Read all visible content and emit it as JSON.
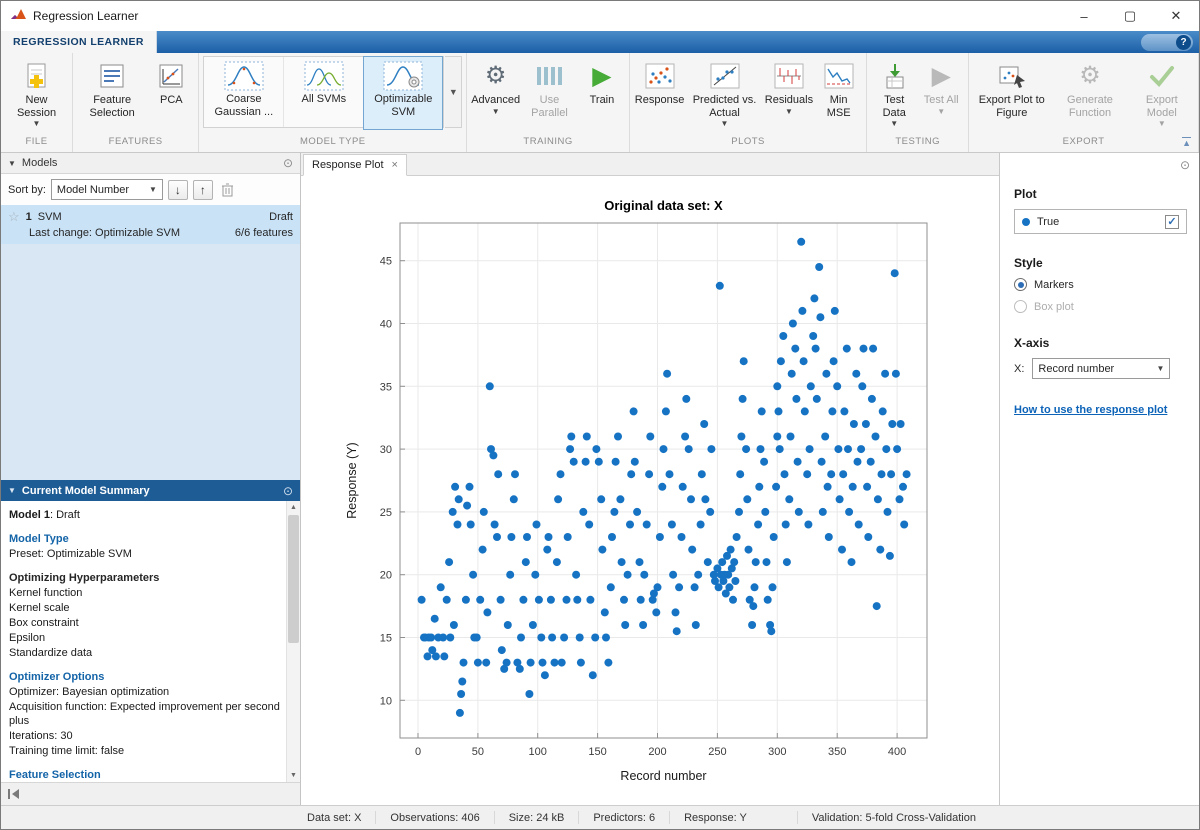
{
  "window": {
    "title": "Regression Learner",
    "minimize": "–",
    "maximize": "▢",
    "close": "✕"
  },
  "tabstrip": {
    "main_tab": "REGRESSION LEARNER",
    "help": "?"
  },
  "ribbon": {
    "file": {
      "label": "FILE",
      "new_session": "New Session"
    },
    "features": {
      "label": "FEATURES",
      "feature_selection": "Feature Selection",
      "pca": "PCA"
    },
    "model_type": {
      "label": "MODEL TYPE",
      "items": [
        "Coarse Gaussian ...",
        "All SVMs",
        "Optimizable SVM"
      ],
      "selected": "Optimizable SVM"
    },
    "training": {
      "label": "TRAINING",
      "advanced": "Advanced",
      "use_parallel": "Use Parallel",
      "train": "Train"
    },
    "plots": {
      "label": "PLOTS",
      "response": "Response",
      "predicted_vs_actual": "Predicted vs. Actual",
      "residuals": "Residuals",
      "min_mse": "Min MSE"
    },
    "testing": {
      "label": "TESTING",
      "test_data": "Test Data",
      "test_all": "Test All"
    },
    "export": {
      "label": "EXPORT",
      "export_plot": "Export Plot to Figure",
      "generate_function": "Generate Function",
      "export_model": "Export Model"
    }
  },
  "models_panel": {
    "header": "Models",
    "sort_label": "Sort by:",
    "sort_value": "Model Number",
    "model": {
      "number": "1",
      "name": "SVM",
      "status": "Draft",
      "last_change": "Last change: Optimizable SVM",
      "features": "6/6 features"
    }
  },
  "summary_panel": {
    "header": "Current Model Summary",
    "model_bold": "Model 1",
    "model_rest": ": Draft",
    "model_type_heading": "Model Type",
    "preset": "Preset: Optimizable SVM",
    "hyper_heading": "Optimizing Hyperparameters",
    "hyper_items": [
      "Kernel function",
      "Kernel scale",
      "Box constraint",
      "Epsilon",
      "Standardize data"
    ],
    "optimizer_heading": "Optimizer Options",
    "optimizer_items": [
      "Optimizer: Bayesian optimization",
      "Acquisition function: Expected improvement per second plus",
      "Iterations: 30",
      "Training time limit: false"
    ],
    "feature_heading": "Feature Selection"
  },
  "document": {
    "tab": "Response Plot",
    "close": "×"
  },
  "plot_controls": {
    "plot_heading": "Plot",
    "legend_true": "True",
    "style_heading": "Style",
    "markers": "Markers",
    "box_plot": "Box plot",
    "xaxis_heading": "X-axis",
    "x_label": "X:",
    "x_value": "Record number",
    "help_link": "How to use the response plot"
  },
  "status_bar": {
    "items": [
      "Data set: X",
      "Observations: 406",
      "Size: 24 kB",
      "Predictors: 6",
      "Response: Y",
      "Validation: 5-fold Cross-Validation"
    ]
  },
  "chart_data": {
    "type": "scatter",
    "title": "Original data set: X",
    "xlabel": "Record number",
    "ylabel": "Response (Y)",
    "xlim": [
      -15,
      425
    ],
    "ylim": [
      7,
      48
    ],
    "xticks": [
      0,
      50,
      100,
      150,
      200,
      250,
      300,
      350,
      400
    ],
    "yticks": [
      10,
      15,
      20,
      25,
      30,
      35,
      40,
      45
    ],
    "grid": true,
    "marker_color": "#1673c4",
    "legend": [
      {
        "label": "True",
        "color": "#1673c4",
        "position": "right-panel"
      }
    ],
    "points": [
      [
        3,
        18
      ],
      [
        5,
        15
      ],
      [
        6,
        15
      ],
      [
        8,
        13.5
      ],
      [
        9,
        15
      ],
      [
        11,
        15
      ],
      [
        12,
        14
      ],
      [
        14,
        16.5
      ],
      [
        15,
        13.5
      ],
      [
        17,
        15
      ],
      [
        19,
        19
      ],
      [
        21,
        15
      ],
      [
        22,
        13.5
      ],
      [
        24,
        18
      ],
      [
        26,
        21
      ],
      [
        27,
        15
      ],
      [
        29,
        25
      ],
      [
        30,
        16
      ],
      [
        31,
        27
      ],
      [
        33,
        24
      ],
      [
        34,
        26
      ],
      [
        35,
        9
      ],
      [
        36,
        10.5
      ],
      [
        37,
        11.5
      ],
      [
        38,
        13
      ],
      [
        40,
        18
      ],
      [
        41,
        25.5
      ],
      [
        43,
        27
      ],
      [
        44,
        24
      ],
      [
        46,
        20
      ],
      [
        47,
        15
      ],
      [
        49,
        15
      ],
      [
        50,
        13
      ],
      [
        52,
        18
      ],
      [
        54,
        22
      ],
      [
        55,
        25
      ],
      [
        57,
        13
      ],
      [
        58,
        17
      ],
      [
        60,
        35
      ],
      [
        61,
        30
      ],
      [
        63,
        29.5
      ],
      [
        64,
        24
      ],
      [
        66,
        23
      ],
      [
        67,
        28
      ],
      [
        69,
        18
      ],
      [
        70,
        14
      ],
      [
        72,
        12.5
      ],
      [
        74,
        13
      ],
      [
        75,
        16
      ],
      [
        77,
        20
      ],
      [
        78,
        23
      ],
      [
        80,
        26
      ],
      [
        81,
        28
      ],
      [
        83,
        13
      ],
      [
        85,
        12.5
      ],
      [
        86,
        15
      ],
      [
        88,
        18
      ],
      [
        90,
        21
      ],
      [
        91,
        23
      ],
      [
        93,
        10.5
      ],
      [
        94,
        13
      ],
      [
        96,
        16
      ],
      [
        98,
        20
      ],
      [
        99,
        24
      ],
      [
        101,
        18
      ],
      [
        103,
        15
      ],
      [
        104,
        13
      ],
      [
        106,
        12
      ],
      [
        108,
        22
      ],
      [
        109,
        23
      ],
      [
        111,
        18
      ],
      [
        112,
        15
      ],
      [
        114,
        13
      ],
      [
        116,
        21
      ],
      [
        117,
        26
      ],
      [
        119,
        28
      ],
      [
        120,
        13
      ],
      [
        122,
        15
      ],
      [
        124,
        18
      ],
      [
        125,
        23
      ],
      [
        127,
        30
      ],
      [
        128,
        31
      ],
      [
        130,
        29
      ],
      [
        132,
        20
      ],
      [
        133,
        18
      ],
      [
        135,
        15
      ],
      [
        136,
        13
      ],
      [
        138,
        25
      ],
      [
        140,
        29
      ],
      [
        141,
        31
      ],
      [
        143,
        24
      ],
      [
        144,
        18
      ],
      [
        146,
        12
      ],
      [
        148,
        15
      ],
      [
        149,
        30
      ],
      [
        151,
        29
      ],
      [
        153,
        26
      ],
      [
        154,
        22
      ],
      [
        156,
        17
      ],
      [
        157,
        15
      ],
      [
        159,
        13
      ],
      [
        161,
        19
      ],
      [
        162,
        23
      ],
      [
        164,
        25
      ],
      [
        165,
        29
      ],
      [
        167,
        31
      ],
      [
        169,
        26
      ],
      [
        170,
        21
      ],
      [
        172,
        18
      ],
      [
        173,
        16
      ],
      [
        175,
        20
      ],
      [
        177,
        24
      ],
      [
        178,
        28
      ],
      [
        180,
        33
      ],
      [
        181,
        29
      ],
      [
        183,
        25
      ],
      [
        185,
        21
      ],
      [
        186,
        18
      ],
      [
        188,
        16
      ],
      [
        189,
        20
      ],
      [
        191,
        24
      ],
      [
        193,
        28
      ],
      [
        194,
        31
      ],
      [
        196,
        18
      ],
      [
        197,
        18.5
      ],
      [
        199,
        17
      ],
      [
        200,
        19
      ],
      [
        202,
        23
      ],
      [
        204,
        27
      ],
      [
        205,
        30
      ],
      [
        207,
        33
      ],
      [
        208,
        36
      ],
      [
        210,
        28
      ],
      [
        212,
        24
      ],
      [
        213,
        20
      ],
      [
        215,
        17
      ],
      [
        216,
        15.5
      ],
      [
        218,
        19
      ],
      [
        220,
        23
      ],
      [
        221,
        27
      ],
      [
        223,
        31
      ],
      [
        224,
        34
      ],
      [
        226,
        30
      ],
      [
        228,
        26
      ],
      [
        229,
        22
      ],
      [
        231,
        19
      ],
      [
        232,
        16
      ],
      [
        234,
        20
      ],
      [
        236,
        24
      ],
      [
        237,
        28
      ],
      [
        239,
        32
      ],
      [
        240,
        26
      ],
      [
        242,
        21
      ],
      [
        244,
        25
      ],
      [
        245,
        30
      ],
      [
        247,
        20
      ],
      [
        248,
        19.5
      ],
      [
        250,
        20.5
      ],
      [
        251,
        19
      ],
      [
        252,
        43
      ],
      [
        253,
        20
      ],
      [
        254,
        21
      ],
      [
        255,
        19.5
      ],
      [
        256,
        20
      ],
      [
        257,
        18.5
      ],
      [
        258,
        21.5
      ],
      [
        259,
        20
      ],
      [
        260,
        19
      ],
      [
        261,
        22
      ],
      [
        262,
        20.5
      ],
      [
        263,
        18
      ],
      [
        264,
        21
      ],
      [
        265,
        19.5
      ],
      [
        266,
        23
      ],
      [
        268,
        25
      ],
      [
        269,
        28
      ],
      [
        270,
        31
      ],
      [
        271,
        34
      ],
      [
        272,
        37
      ],
      [
        274,
        30
      ],
      [
        275,
        26
      ],
      [
        276,
        22
      ],
      [
        277,
        18
      ],
      [
        279,
        16
      ],
      [
        280,
        17.5
      ],
      [
        281,
        19
      ],
      [
        282,
        21
      ],
      [
        284,
        24
      ],
      [
        285,
        27
      ],
      [
        286,
        30
      ],
      [
        287,
        33
      ],
      [
        289,
        29
      ],
      [
        290,
        25
      ],
      [
        291,
        21
      ],
      [
        292,
        18
      ],
      [
        294,
        16
      ],
      [
        295,
        15.5
      ],
      [
        296,
        19
      ],
      [
        297,
        23
      ],
      [
        299,
        27
      ],
      [
        300,
        31
      ],
      [
        300,
        35
      ],
      [
        301,
        33
      ],
      [
        302,
        30
      ],
      [
        303,
        37
      ],
      [
        305,
        39
      ],
      [
        306,
        28
      ],
      [
        307,
        24
      ],
      [
        308,
        21
      ],
      [
        310,
        26
      ],
      [
        311,
        31
      ],
      [
        312,
        36
      ],
      [
        313,
        40
      ],
      [
        315,
        38
      ],
      [
        316,
        34
      ],
      [
        317,
        29
      ],
      [
        318,
        25
      ],
      [
        320,
        46.5
      ],
      [
        321,
        41
      ],
      [
        322,
        37
      ],
      [
        323,
        33
      ],
      [
        325,
        28
      ],
      [
        326,
        24
      ],
      [
        327,
        30
      ],
      [
        328,
        35
      ],
      [
        330,
        39
      ],
      [
        331,
        42
      ],
      [
        332,
        38
      ],
      [
        333,
        34
      ],
      [
        335,
        44.5
      ],
      [
        336,
        40.5
      ],
      [
        337,
        29
      ],
      [
        338,
        25
      ],
      [
        340,
        31
      ],
      [
        341,
        36
      ],
      [
        342,
        27
      ],
      [
        343,
        23
      ],
      [
        345,
        28
      ],
      [
        346,
        33
      ],
      [
        347,
        37
      ],
      [
        348,
        41
      ],
      [
        350,
        35
      ],
      [
        351,
        30
      ],
      [
        352,
        26
      ],
      [
        354,
        22
      ],
      [
        355,
        28
      ],
      [
        356,
        33
      ],
      [
        358,
        38
      ],
      [
        359,
        30
      ],
      [
        360,
        25
      ],
      [
        362,
        21
      ],
      [
        363,
        27
      ],
      [
        364,
        32
      ],
      [
        366,
        36
      ],
      [
        367,
        29
      ],
      [
        368,
        24
      ],
      [
        370,
        30
      ],
      [
        371,
        35
      ],
      [
        372,
        38
      ],
      [
        374,
        32
      ],
      [
        375,
        27
      ],
      [
        376,
        23
      ],
      [
        378,
        29
      ],
      [
        379,
        34
      ],
      [
        380,
        38
      ],
      [
        382,
        31
      ],
      [
        383,
        17.5
      ],
      [
        384,
        26
      ],
      [
        386,
        22
      ],
      [
        387,
        28
      ],
      [
        388,
        33
      ],
      [
        390,
        36
      ],
      [
        391,
        30
      ],
      [
        392,
        25
      ],
      [
        394,
        21.5
      ],
      [
        395,
        28
      ],
      [
        396,
        32
      ],
      [
        398,
        44
      ],
      [
        399,
        36
      ],
      [
        400,
        30
      ],
      [
        402,
        26
      ],
      [
        403,
        32
      ],
      [
        405,
        27
      ],
      [
        406,
        24
      ],
      [
        408,
        28
      ]
    ]
  }
}
